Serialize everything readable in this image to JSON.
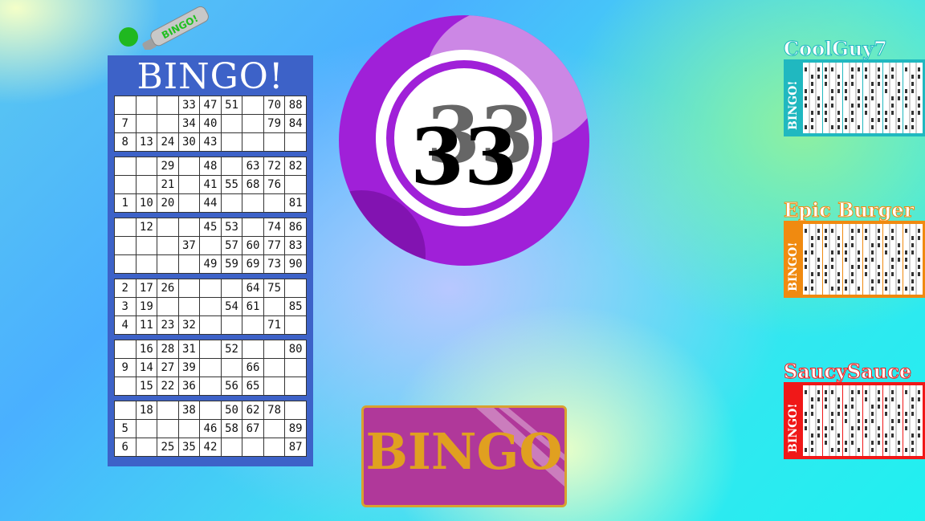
{
  "dauber": {
    "label": "BINGO!"
  },
  "card": {
    "title": "BINGO!",
    "tickets": [
      [
        [
          "",
          "",
          "",
          "33",
          "47",
          "51",
          "",
          "70",
          "88"
        ],
        [
          "7",
          "",
          "",
          "34",
          "40",
          "",
          "",
          "79",
          "84"
        ],
        [
          "8",
          "13",
          "24",
          "30",
          "43",
          "",
          "",
          "",
          ""
        ]
      ],
      [
        [
          "",
          "",
          "29",
          "",
          "48",
          "",
          "63",
          "72",
          "82"
        ],
        [
          "",
          "",
          "21",
          "",
          "41",
          "55",
          "68",
          "76",
          ""
        ],
        [
          "1",
          "10",
          "20",
          "",
          "44",
          "",
          "",
          "",
          "81"
        ]
      ],
      [
        [
          "",
          "12",
          "",
          "",
          "45",
          "53",
          "",
          "74",
          "86"
        ],
        [
          "",
          "",
          "",
          "37",
          "",
          "57",
          "60",
          "77",
          "83"
        ],
        [
          "",
          "",
          "",
          "",
          "49",
          "59",
          "69",
          "73",
          "90"
        ]
      ],
      [
        [
          "2",
          "17",
          "26",
          "",
          "",
          "",
          "64",
          "75",
          ""
        ],
        [
          "3",
          "19",
          "",
          "",
          "",
          "54",
          "61",
          "",
          "85"
        ],
        [
          "4",
          "11",
          "23",
          "32",
          "",
          "",
          "",
          "71",
          ""
        ]
      ],
      [
        [
          "",
          "16",
          "28",
          "31",
          "",
          "52",
          "",
          "",
          "80"
        ],
        [
          "9",
          "14",
          "27",
          "39",
          "",
          "",
          "66",
          "",
          ""
        ],
        [
          "",
          "15",
          "22",
          "36",
          "",
          "56",
          "65",
          "",
          ""
        ]
      ],
      [
        [
          "",
          "18",
          "",
          "38",
          "",
          "50",
          "62",
          "78",
          ""
        ],
        [
          "5",
          "",
          "",
          "",
          "46",
          "58",
          "67",
          "",
          "89"
        ],
        [
          "6",
          "",
          "25",
          "35",
          "42",
          "",
          "",
          "",
          "87"
        ]
      ]
    ]
  },
  "ball": {
    "number": "33",
    "color": "#a020d8"
  },
  "bingo_button": {
    "label": "BINGO"
  },
  "opponents": [
    {
      "name": "CoolGuy7",
      "color": "#20b8c0",
      "label": "BINGO!"
    },
    {
      "name": "Epic Burger",
      "color": "#f08a10",
      "label": "BINGO!"
    },
    {
      "name": "SaucySauce",
      "color": "#f01818",
      "label": "BINGO!"
    }
  ]
}
